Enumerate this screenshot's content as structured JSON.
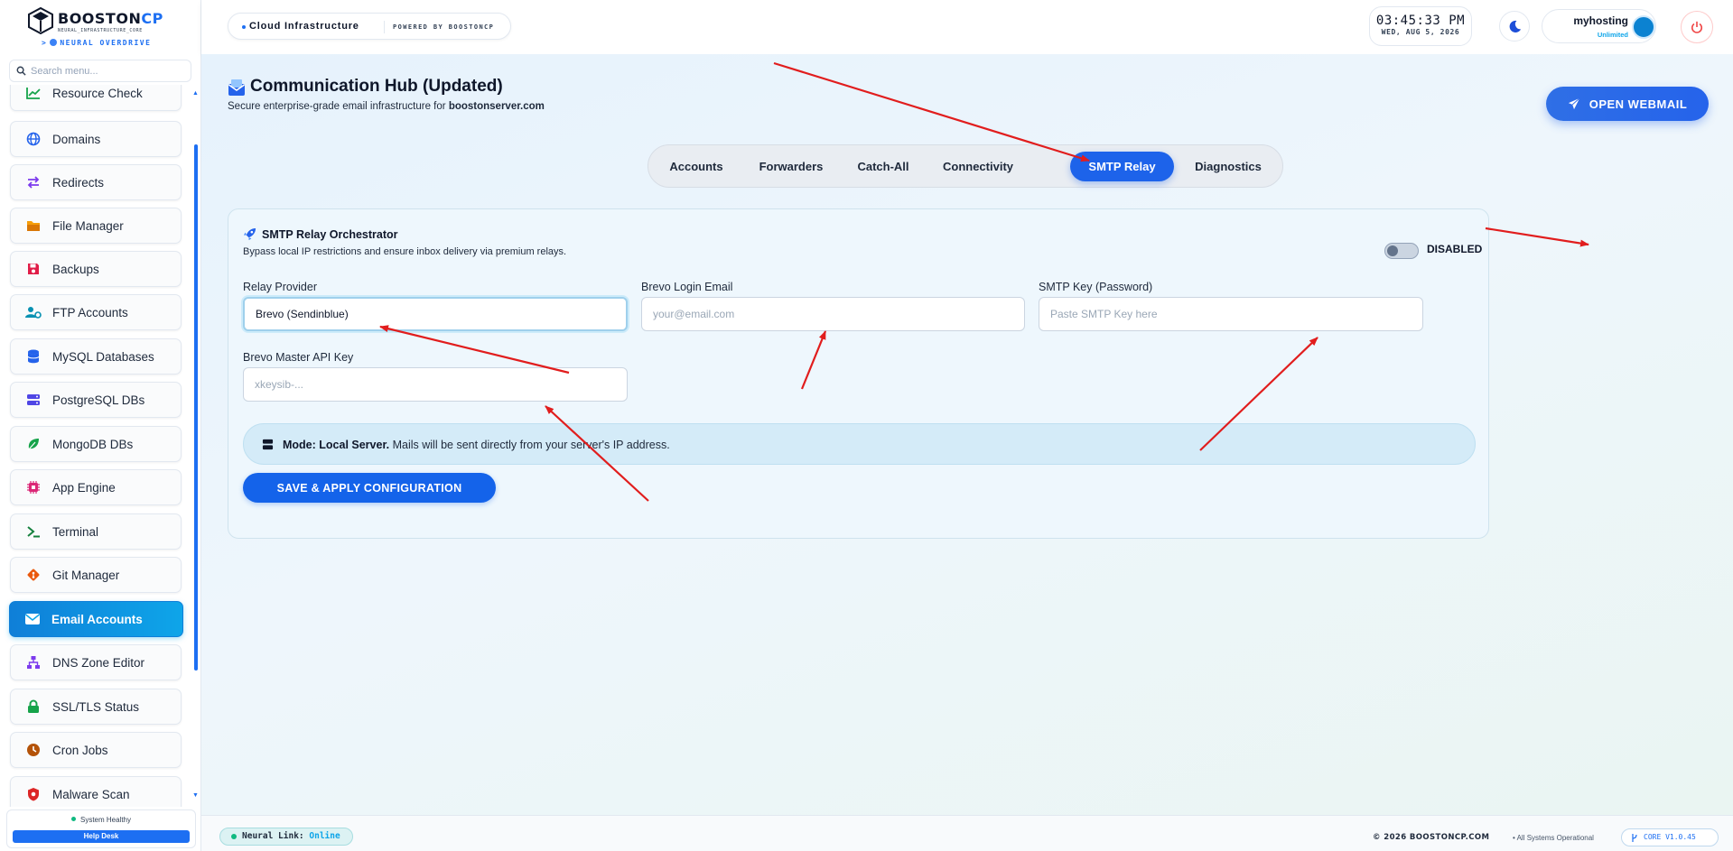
{
  "brand": {
    "name_main": "BOOSTON",
    "name_accent": "CP",
    "tagline": "NEURAL_INFRASTRUCTURE_CORE",
    "mode": "NEURAL OVERDRIVE"
  },
  "search": {
    "placeholder": "Search menu..."
  },
  "sidebar": {
    "items": [
      {
        "label": "Resource Check",
        "icon": "chart-line-icon",
        "color": "#16a34a"
      },
      {
        "label": "Domains",
        "icon": "globe-icon",
        "color": "#2563eb"
      },
      {
        "label": "Redirects",
        "icon": "arrows-exchange-icon",
        "color": "#7c3aed"
      },
      {
        "label": "File Manager",
        "icon": "folder-icon",
        "color": "#d97706"
      },
      {
        "label": "Backups",
        "icon": "floppy-icon",
        "color": "#e11d48"
      },
      {
        "label": "FTP Accounts",
        "icon": "user-cog-icon",
        "color": "#0891b2"
      },
      {
        "label": "MySQL Databases",
        "icon": "database-icon",
        "color": "#2563eb"
      },
      {
        "label": "PostgreSQL DBs",
        "icon": "server-icon",
        "color": "#4f46e5"
      },
      {
        "label": "MongoDB DBs",
        "icon": "leaf-icon",
        "color": "#16a34a"
      },
      {
        "label": "App Engine",
        "icon": "chip-icon",
        "color": "#db2777"
      },
      {
        "label": "Terminal",
        "icon": "terminal-icon",
        "color": "#15803d"
      },
      {
        "label": "Git Manager",
        "icon": "git-icon",
        "color": "#ea580c"
      },
      {
        "label": "Email Accounts",
        "icon": "envelope-icon",
        "color": "#ffffff",
        "active": true
      },
      {
        "label": "DNS Zone Editor",
        "icon": "sitemap-icon",
        "color": "#7c3aed"
      },
      {
        "label": "SSL/TLS Status",
        "icon": "lock-icon",
        "color": "#16a34a"
      },
      {
        "label": "Cron Jobs",
        "icon": "clock-icon",
        "color": "#b45309"
      },
      {
        "label": "Malware Scan",
        "icon": "shield-virus-icon",
        "color": "#dc2626"
      }
    ]
  },
  "status": {
    "health": "System Healthy",
    "help": "Help Desk"
  },
  "header": {
    "breadcrumb": "Cloud Infrastructure",
    "powered": "POWERED BY BOOSTONCP",
    "time": "03:45:33 PM",
    "date": "WED, AUG 5, 2026",
    "user": "myhosting",
    "plan": "Unlimited"
  },
  "page": {
    "title": "Communication Hub (Updated)",
    "subtitle_prefix": "Secure enterprise-grade email infrastructure for",
    "domain": "boostonserver.com",
    "webmail_button": "OPEN WEBMAIL"
  },
  "tabs": [
    {
      "label": "Accounts",
      "active": false
    },
    {
      "label": "Forwarders",
      "active": false
    },
    {
      "label": "Catch-All",
      "active": false
    },
    {
      "label": "Connectivity",
      "active": false
    },
    {
      "label": "SMTP Relay",
      "active": true
    },
    {
      "label": "Diagnostics",
      "active": false
    }
  ],
  "relay": {
    "title": "SMTP Relay Orchestrator",
    "subtitle": "Bypass local IP restrictions and ensure inbox delivery via premium relays.",
    "toggle_state": "DISABLED",
    "enabled": false,
    "provider_label": "Relay Provider",
    "provider_value": "Brevo (Sendinblue)",
    "email_label": "Brevo Login Email",
    "email_placeholder": "your@email.com",
    "smtp_key_label": "SMTP Key (Password)",
    "smtp_key_placeholder": "Paste SMTP Key here",
    "api_key_label": "Brevo Master API Key",
    "api_key_placeholder": "xkeysib-...",
    "mode_label": "Mode: Local Server.",
    "mode_text": "Mails will be sent directly from your server's IP address.",
    "save_button": "SAVE & APPLY CONFIGURATION"
  },
  "footer": {
    "neural_label": "Neural Link:",
    "neural_status": "Online",
    "copyright": "© 2026 BOOSTONCP.COM",
    "ops": "All Systems Operational",
    "version": "CORE V1.0.45"
  },
  "colors": {
    "accent": "#1d63ea",
    "active_menu": "#0ea5e9",
    "annotation_arrow": "#e11d1d",
    "status_ok": "#10b981"
  }
}
